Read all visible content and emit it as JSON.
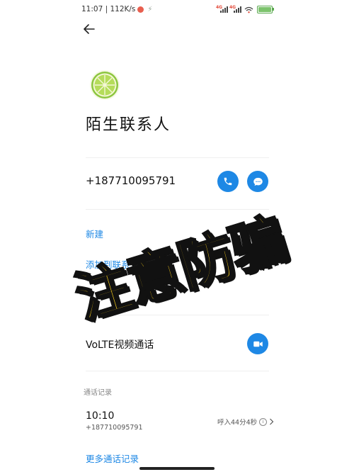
{
  "status_bar": {
    "time_speed": "11:07 | 112K/s",
    "battery_level": 0.9
  },
  "contact": {
    "name": "陌生联系人",
    "phone": "+187710095791"
  },
  "actions": {
    "new_label": "新建",
    "add_to_contact_label": "添加到联系人"
  },
  "volte": {
    "label": "VoLTE视频通话"
  },
  "call_log": {
    "section_title": "通话记录",
    "entries": [
      {
        "time": "10:10",
        "number": "+187710095791",
        "detail": "呼入44分4秒"
      }
    ],
    "more_label": "更多通话记录"
  },
  "overlay": {
    "text": "注意防骗"
  },
  "icons": {
    "back": "arrow-left-icon",
    "call": "phone-icon",
    "message": "chat-bubble-icon",
    "video": "video-camera-icon",
    "avatar": "lime-slice-icon",
    "chevron": "chevron-right-icon"
  },
  "colors": {
    "accent": "#1e88e5",
    "overlay_fill": "#ffd21a",
    "overlay_stroke": "#111111"
  }
}
